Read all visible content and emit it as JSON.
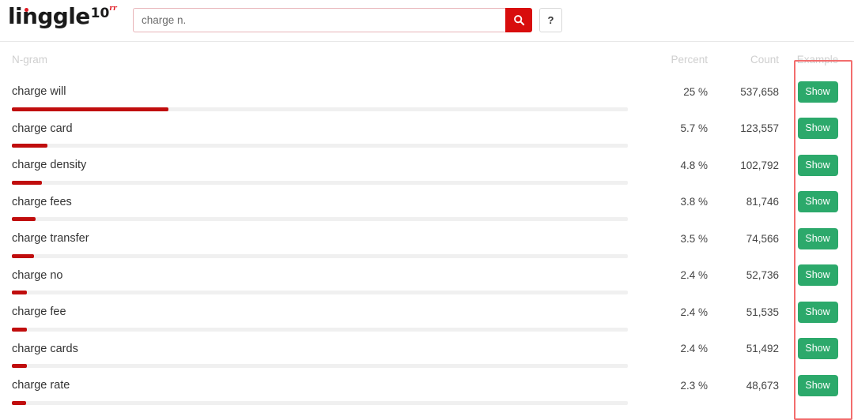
{
  "header": {
    "logo": {
      "word": "linggle",
      "version": "10",
      "superscript": "rr"
    },
    "search": {
      "value": "charge n.",
      "placeholder": "charge n.",
      "search_icon": "search-icon",
      "search_button_label": "",
      "help_button_label": "?"
    }
  },
  "table": {
    "columns": {
      "ngram": "N-gram",
      "percent": "Percent",
      "count": "Count",
      "example": "Example"
    },
    "action_label": "Show",
    "rows": [
      {
        "ngram": "charge will",
        "percent": "25 %",
        "count": "537,658",
        "bar": 25.0,
        "action": "Show"
      },
      {
        "ngram": "charge card",
        "percent": "5.7 %",
        "count": "123,557",
        "bar": 5.7,
        "action": "Show"
      },
      {
        "ngram": "charge density",
        "percent": "4.8 %",
        "count": "102,792",
        "bar": 4.8,
        "action": "Show"
      },
      {
        "ngram": "charge fees",
        "percent": "3.8 %",
        "count": "81,746",
        "bar": 3.8,
        "action": "Show"
      },
      {
        "ngram": "charge transfer",
        "percent": "3.5 %",
        "count": "74,566",
        "bar": 3.5,
        "action": "Show"
      },
      {
        "ngram": "charge no",
        "percent": "2.4 %",
        "count": "52,736",
        "bar": 2.4,
        "action": "Show"
      },
      {
        "ngram": "charge fee",
        "percent": "2.4 %",
        "count": "51,535",
        "bar": 2.4,
        "action": "Show"
      },
      {
        "ngram": "charge cards",
        "percent": "2.4 %",
        "count": "51,492",
        "bar": 2.4,
        "action": "Show"
      },
      {
        "ngram": "charge rate",
        "percent": "2.3 %",
        "count": "48,673",
        "bar": 2.3,
        "action": "Show"
      }
    ]
  },
  "annotation": {
    "highlight_color": "#f26d6d",
    "highlight_target": "example-column"
  },
  "colors": {
    "brand_red": "#d80d0d",
    "bar_red": "#c00d0d",
    "show_green": "#2ca96b",
    "header_gray": "#cfcfcf"
  },
  "chart_data": {
    "type": "bar",
    "title": "",
    "xlabel": "Percent",
    "ylabel": "N-gram",
    "categories": [
      "charge will",
      "charge card",
      "charge density",
      "charge fees",
      "charge transfer",
      "charge no",
      "charge fee",
      "charge cards",
      "charge rate"
    ],
    "values": [
      25.0,
      5.7,
      4.8,
      3.8,
      3.5,
      2.4,
      2.4,
      2.4,
      2.3
    ],
    "counts": [
      537658,
      123557,
      102792,
      81746,
      74566,
      52736,
      51535,
      51492,
      48673
    ],
    "xlim": [
      0,
      100
    ],
    "grid": false,
    "legend": "none"
  }
}
